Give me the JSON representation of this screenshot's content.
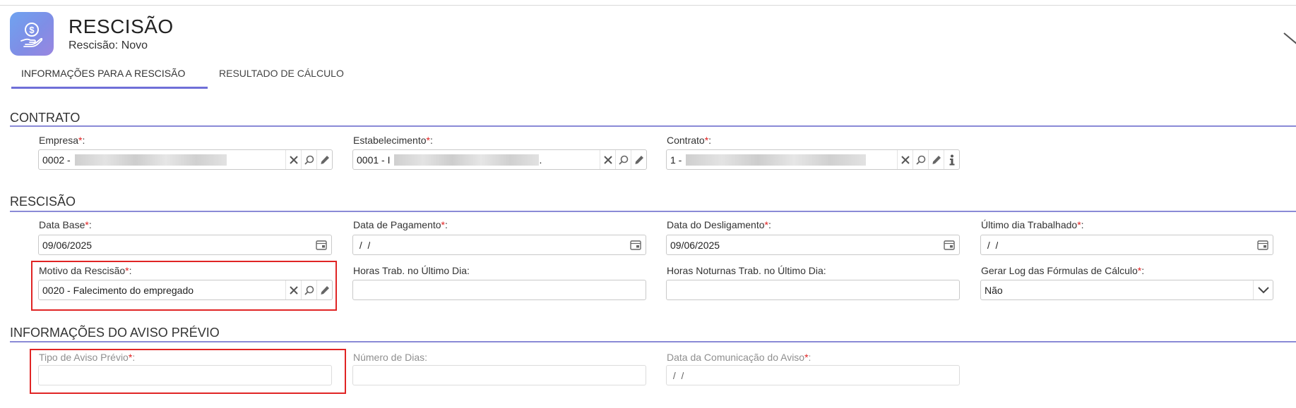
{
  "app": {
    "icon": "dollar-hand-icon",
    "title": "RESCISÃO",
    "subtitle": "Rescisão: Novo"
  },
  "tabs": [
    {
      "label": "INFORMAÇÕES PARA A RESCISÃO",
      "active": true
    },
    {
      "label": "RESULTADO DE CÁLCULO",
      "active": false
    }
  ],
  "sections": {
    "contrato": "CONTRATO",
    "rescisao": "RESCISÃO",
    "aviso": "INFORMAÇÕES DO AVISO PRÉVIO"
  },
  "required_mark": "*",
  "label_suffix": ":",
  "contrato": {
    "empresa": {
      "label": "Empresa",
      "value": "0002 -"
    },
    "estabelecimento": {
      "label": "Estabelecimento",
      "value": "0001 - I",
      "value_end": "."
    },
    "contrato": {
      "label": "Contrato",
      "value": "1 -"
    }
  },
  "rescisao": {
    "data_base": {
      "label": "Data Base",
      "value": "09/06/2025"
    },
    "data_pagamento": {
      "label": "Data de Pagamento",
      "value": " /  /"
    },
    "data_desligamento": {
      "label": "Data do Desligamento",
      "value": "09/06/2025"
    },
    "ultimo_dia": {
      "label": "Último dia Trabalhado",
      "value": " /  /"
    },
    "motivo": {
      "label": "Motivo da Rescisão",
      "value": "0020 - Falecimento do empregado"
    },
    "horas_trab": {
      "label": "Horas Trab. no Último Dia:",
      "value": ""
    },
    "horas_noturnas": {
      "label": "Horas Noturnas Trab. no Último Dia:",
      "value": ""
    },
    "gerar_log": {
      "label": "Gerar Log das Fórmulas de Cálculo",
      "value": "Não"
    }
  },
  "aviso": {
    "tipo": {
      "label": "Tipo de Aviso Prévio",
      "value": ""
    },
    "numero_dias": {
      "label": "Número de Dias:",
      "value": ""
    },
    "data_comunicacao": {
      "label": "Data da Comunicação do Aviso",
      "value": " /  /"
    }
  },
  "colors": {
    "accent": "#7777d8",
    "required": "#e02020",
    "highlight": "#e02424"
  }
}
